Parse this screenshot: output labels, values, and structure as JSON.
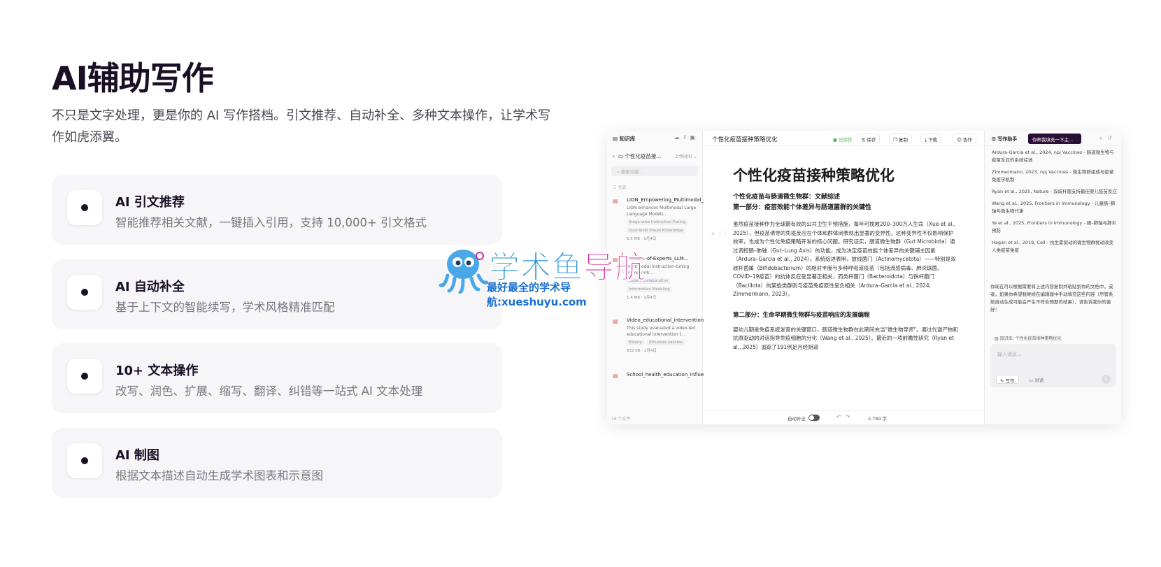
{
  "hero": {
    "title": "AI辅助写作",
    "subtitle": "不只是文字处理，更是你的 AI 写作搭档。引文推荐、自动补全、多种文本操作，让学术写作如虎添翼。"
  },
  "features": [
    {
      "title": "AI 引文推荐",
      "desc": "智能推荐相关文献，一键插入引用，支持 10,000+ 引文格式"
    },
    {
      "title": "AI 自动补全",
      "desc": "基于上下文的智能续写，学术风格精准匹配"
    },
    {
      "title": "10+ 文本操作",
      "desc": "改写、润色、扩展、缩写、翻译、纠错等一站式 AI 文本处理"
    },
    {
      "title": "AI 制图",
      "desc": "根据文本描述自动生成学术图表和示意图"
    }
  ],
  "app": {
    "kb": {
      "header": "知识库",
      "folder": "个性化疫苗接...",
      "sort": "上传时间",
      "search_placeholder": "搜索文献...",
      "select_all": "全选",
      "docs": [
        {
          "title": "LION_Empowering_Multimodal_LLM_with_Dual-...",
          "desc": "LION enhances Multimodal Large Language Models...",
          "tags": [
            "Stage-wise Instruction-Tuning",
            "Dual-level Visual Knowledge"
          ],
          "meta": "6.5 MB · 1月4日"
        },
        {
          "title": "Mixture-of-Experts_LLM...",
          "desc": "multimodal instruction-tuning framework...",
          "tags": [
            "Expert Collaboration",
            "Information Modeling"
          ],
          "meta": "1.4 MB · 1月4日"
        },
        {
          "title": "Video_educational_intervention_influenza_vaccine...",
          "desc": "This study evaluated a video-led educational intervention t...",
          "tags": [
            "Elderly",
            "Influenza vaccine"
          ],
          "meta": "832 KB · 1月4日"
        },
        {
          "title": "School_health_education_influenza_vaccination_R...",
          "desc": "",
          "tags": [],
          "meta": ""
        }
      ],
      "footer": "16 个文件"
    },
    "editor": {
      "doc_name": "个性化疫苗接种策略优化",
      "saved": "● 已保存",
      "btn_save": "保存",
      "btn_copy": "复制",
      "btn_download": "下载",
      "btn_collab": "协作",
      "h1": "个性化疫苗接种策略优化",
      "h2a": "个性化疫苗与肠道微生物群：文献综述",
      "h2b": "第一部分：疫苗效能个体差异与肠道菌群的关键性",
      "p1": "虽然疫苗接种作为全球最有效的公共卫生干预措施，每年可挽救200–300万人生命（Xue et al., 2025），但疫苗诱导的免疫反应在个体和群体间表现出显著的变异性。这种变异性不仅影响保护效率，也成为个性化免疫策略开发的核心问题。研究证实，肠道微生物群（Gut Microbiota）通过调控肠–肺轴（Gut–Lung Axis）的功能，成为决定疫苗效能个体差异的关键辅主因素（Ardura–Garcia et al., 2024）。系统综述表明，放线菌门（Actinomycetota）——特别是双歧杆菌属（Bifidobacterium）的相对丰度与多种呼吸道疫苗（包括流感病毒、肺炎球菌、COVID–19疫苗）的抗体反应呈显著正相关，而类杆菌门（Bacteroidota）与铁杆菌门（Bacillota）的某些类群则与疫苗免疫原性呈负相关（Ardura–Garcia et al., 2024; Zimmermann, 2023）。",
      "h3": "第二部分：生命早期微生物群与疫苗响应的发展编程",
      "p2": "婴幼儿期是免疫系统发育的关键窗口，肠道微生物群在此期间充当\"微生物导师\"。通过代谢产物和抗原驱动的对话指导免疫细胞的分化（Wang et al., 2025）。最近的一项前瞻性研究（Ryan et al., 2025）追踪了191例足月经阴道",
      "autocomplete": "自动补全",
      "word_count": "2,789 字"
    },
    "assistant": {
      "title": "写作助手",
      "tab": "你帮我填充一下主...",
      "citations": [
        "Ardura-Garcia et al., 2024, npj Vaccines - 肠道微生物与疫苗反应的系统综述",
        "Zimmermann, 2023, npj Vaccines - 微生物群组成与疫苗免疫学机制",
        "Ryan et al., 2025, Nature - 双歧杆菌支持最佳婴儿疫苗反应",
        "Wang et al., 2025, Frontiers in Immunology - 儿童肠–肺轴与微生物代谢",
        "Ye et al., 2025, Frontiers in Immunology - 肠–肺轴与肺炎预防",
        "Hagan et al., 2019, Cell - 抗生素驱动的微生物群扰动改变人类疫苗免疫"
      ],
      "message": "你现在可以根据需要将上述内容复制并粘贴到你的文档中。或者，如果你希望我继续在编辑器中手动填充这些内容（尽管系统自动生成可能会产生不符合预期的结果），请告诉我你的偏好！",
      "kb_ref": "知识库: 个性化疫苗接种策略优化",
      "input_placeholder": "输入消息...",
      "mode_write": "写作",
      "mode_chat": "对话"
    }
  },
  "watermark": {
    "line1_a": "学术鱼",
    "line1_b": "导航",
    "line2": "最好最全的学术导航:xueshuyu.com"
  },
  "colors": {
    "accent": "#2a0f36",
    "watermark_blue": "#1a8fd6",
    "watermark_pink": "#d4309a"
  }
}
